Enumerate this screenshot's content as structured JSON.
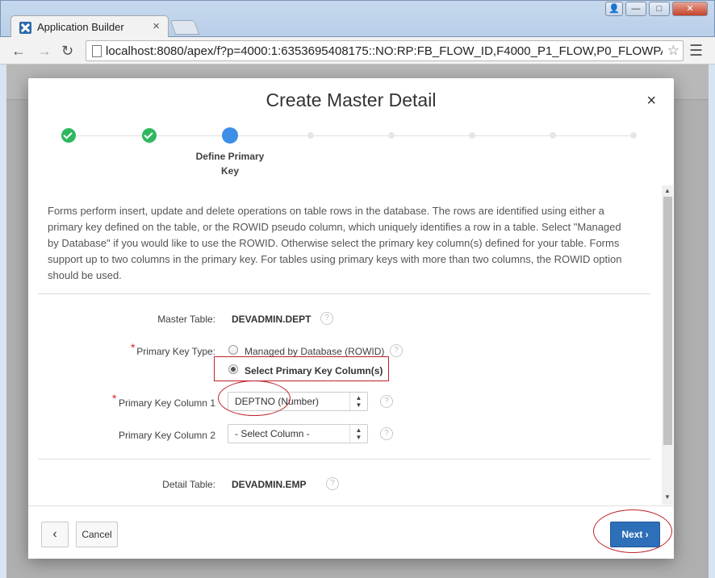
{
  "browser": {
    "tab_title": "Application Builder",
    "tab_close": "×",
    "url": "localhost:8080/apex/f?p=4000:1:6353695408175::NO:RP:FB_FLOW_ID,F4000_P1_FLOW,P0_FLOWPA",
    "window_buttons": [
      "—",
      "□",
      "✕"
    ]
  },
  "dialog": {
    "title": "Create Master Detail",
    "close": "×",
    "current_step_label": "Define Primary Key",
    "description": "Forms perform insert, update and delete operations on table rows in the database. The rows are identified using either a primary key defined on the table, or the ROWID pseudo column, which uniquely identifies a row in a table. Select \"Managed by Database\" if you would like to use the ROWID. Otherwise select the primary key column(s) defined for your table. Forms support up to two columns in the primary key. For tables using primary keys with more than two columns, the ROWID option should be used.",
    "fields": {
      "master_table_label": "Master Table:",
      "master_table_value": "DEVADMIN.DEPT",
      "pk_type_label": "Primary Key Type:",
      "pk_type_option1": "Managed by Database (ROWID)",
      "pk_type_option2": "Select Primary Key Column(s)",
      "pk_col1_label": "Primary Key Column 1",
      "pk_col1_value": "DEPTNO (Number)",
      "pk_col2_label": "Primary Key Column 2",
      "pk_col2_value": "- Select Column -",
      "detail_table_label": "Detail Table:",
      "detail_table_value": "DEVADMIN.EMP",
      "required_marker": "*",
      "help": "?"
    },
    "footer": {
      "back_label": "‹",
      "cancel_label": "Cancel",
      "next_label": "Next ›"
    }
  },
  "steps": {
    "completed": 2,
    "current": 3,
    "total": 8
  },
  "colors": {
    "accent": "#2d6fb8",
    "step_done": "#2fb760",
    "step_current": "#3c8ee6",
    "annotation_red": "#c0202a"
  }
}
